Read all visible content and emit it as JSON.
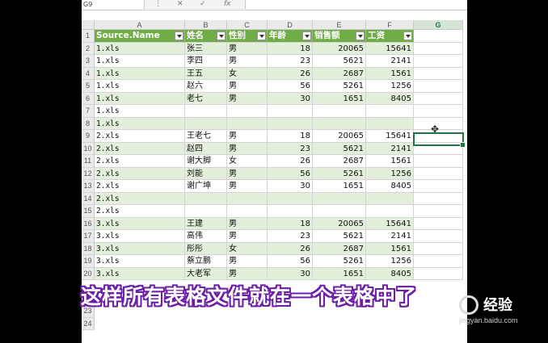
{
  "formula_bar": {
    "name_box": "G9",
    "cancel_icon": "✕",
    "confirm_icon": "✓",
    "fx_label": "fx",
    "menu_dots": "⋮"
  },
  "columns": [
    "A",
    "B",
    "C",
    "D",
    "E",
    "F",
    "G"
  ],
  "header_row": {
    "row": "1",
    "cells": [
      "Source.Name",
      "姓名",
      "性别",
      "年龄",
      "销售额",
      "工资"
    ]
  },
  "rows": [
    {
      "row": "2",
      "cells": [
        "1.xls",
        "张三",
        "男",
        "18",
        "20065",
        "15641"
      ]
    },
    {
      "row": "3",
      "cells": [
        "1.xls",
        "李四",
        "男",
        "23",
        "5621",
        "2141"
      ]
    },
    {
      "row": "4",
      "cells": [
        "1.xls",
        "王五",
        "女",
        "26",
        "2687",
        "1561"
      ]
    },
    {
      "row": "5",
      "cells": [
        "1.xls",
        "赵六",
        "男",
        "56",
        "5261",
        "1256"
      ]
    },
    {
      "row": "6",
      "cells": [
        "1.xls",
        "老七",
        "男",
        "30",
        "1651",
        "8405"
      ]
    },
    {
      "row": "7",
      "cells": [
        "1.xls",
        "",
        "",
        "",
        "",
        ""
      ]
    },
    {
      "row": "8",
      "cells": [
        "1.xls",
        "",
        "",
        "",
        "",
        ""
      ]
    },
    {
      "row": "9",
      "cells": [
        "2.xls",
        "王老七",
        "男",
        "18",
        "20065",
        "15641"
      ]
    },
    {
      "row": "10",
      "cells": [
        "2.xls",
        "赵四",
        "男",
        "23",
        "5621",
        "2141"
      ]
    },
    {
      "row": "11",
      "cells": [
        "2.xls",
        "谢大脚",
        "女",
        "26",
        "2687",
        "1561"
      ]
    },
    {
      "row": "12",
      "cells": [
        "2.xls",
        "刘能",
        "男",
        "56",
        "5261",
        "1256"
      ]
    },
    {
      "row": "13",
      "cells": [
        "2.xls",
        "谢广坤",
        "男",
        "30",
        "1651",
        "8405"
      ]
    },
    {
      "row": "14",
      "cells": [
        "2.xls",
        "",
        "",
        "",
        "",
        ""
      ]
    },
    {
      "row": "15",
      "cells": [
        "2.xls",
        "",
        "",
        "",
        "",
        ""
      ]
    },
    {
      "row": "16",
      "cells": [
        "3.xls",
        "王建",
        "男",
        "18",
        "20065",
        "15641"
      ]
    },
    {
      "row": "17",
      "cells": [
        "3.xls",
        "高伟",
        "男",
        "23",
        "5621",
        "2141"
      ]
    },
    {
      "row": "18",
      "cells": [
        "3.xls",
        "彤彤",
        "女",
        "26",
        "2687",
        "1561"
      ]
    },
    {
      "row": "19",
      "cells": [
        "3.xls",
        "蔡立鹏",
        "男",
        "56",
        "5261",
        "1256"
      ]
    },
    {
      "row": "20",
      "cells": [
        "3.xls",
        "大老军",
        "男",
        "30",
        "1651",
        "8405"
      ]
    }
  ],
  "extra_rows": [
    "23",
    "24"
  ],
  "caption": "这样所有表格文件就在一个表格中了",
  "watermark": {
    "brand": "经验",
    "url": "jingyan.baidu.com"
  },
  "colors": {
    "header_green": "#70ad47",
    "band_green": "#e2efda",
    "selection": "#217346",
    "caption_outline": "#6d1fa8"
  }
}
